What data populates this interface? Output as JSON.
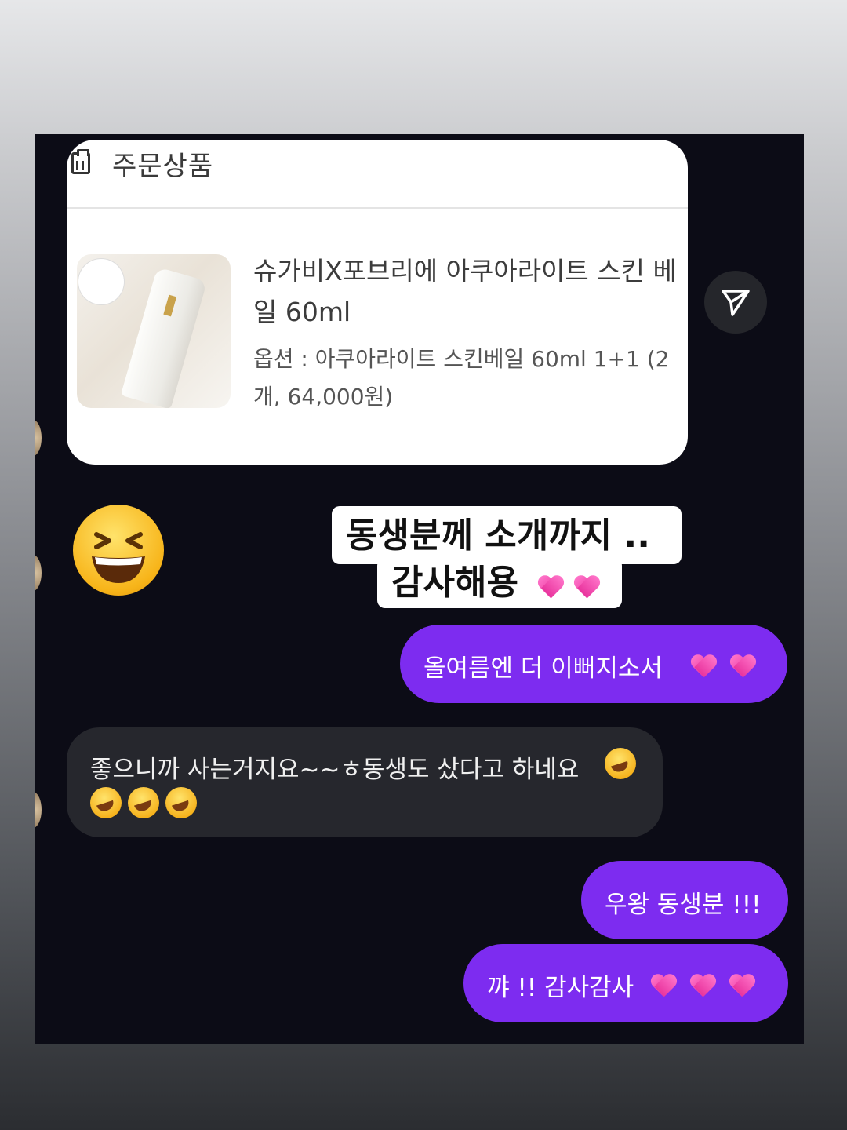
{
  "order_card": {
    "header_title": "주문상품",
    "product_name": "슈가비X포브리에 아쿠아라이트 스킨 베일 60ml",
    "product_option": "옵션 : 아쿠아라이트 스킨베일 60ml 1+1 (2개, 64,000원)",
    "icons": {
      "header": "clipboard-icon",
      "share": "send-icon"
    }
  },
  "sticker": {
    "emoji_icon": "laughing-face-icon",
    "caption_line1": "동생분께  소개까지  ..",
    "caption_line2": "감사해용",
    "caption_icon": "heart-icon"
  },
  "messages": [
    {
      "sender": "me",
      "text": "올여름엔 더 이뻐지소서",
      "emoji_icon": "heart-icon"
    },
    {
      "sender": "them",
      "text": "좋으니까 사는거지요~~ㅎ동생도 샀다고 하네요",
      "emoji_icon": "rolling-laughing-face-icon"
    },
    {
      "sender": "me",
      "text": "우왕 동생분 !!!"
    },
    {
      "sender": "me",
      "text": "꺄 !! 감사감사",
      "emoji_icon": "heart-icon"
    }
  ],
  "colors": {
    "chat_background": "#0c0c16",
    "my_bubble": "#7d2cf0",
    "their_bubble": "#26272d"
  }
}
